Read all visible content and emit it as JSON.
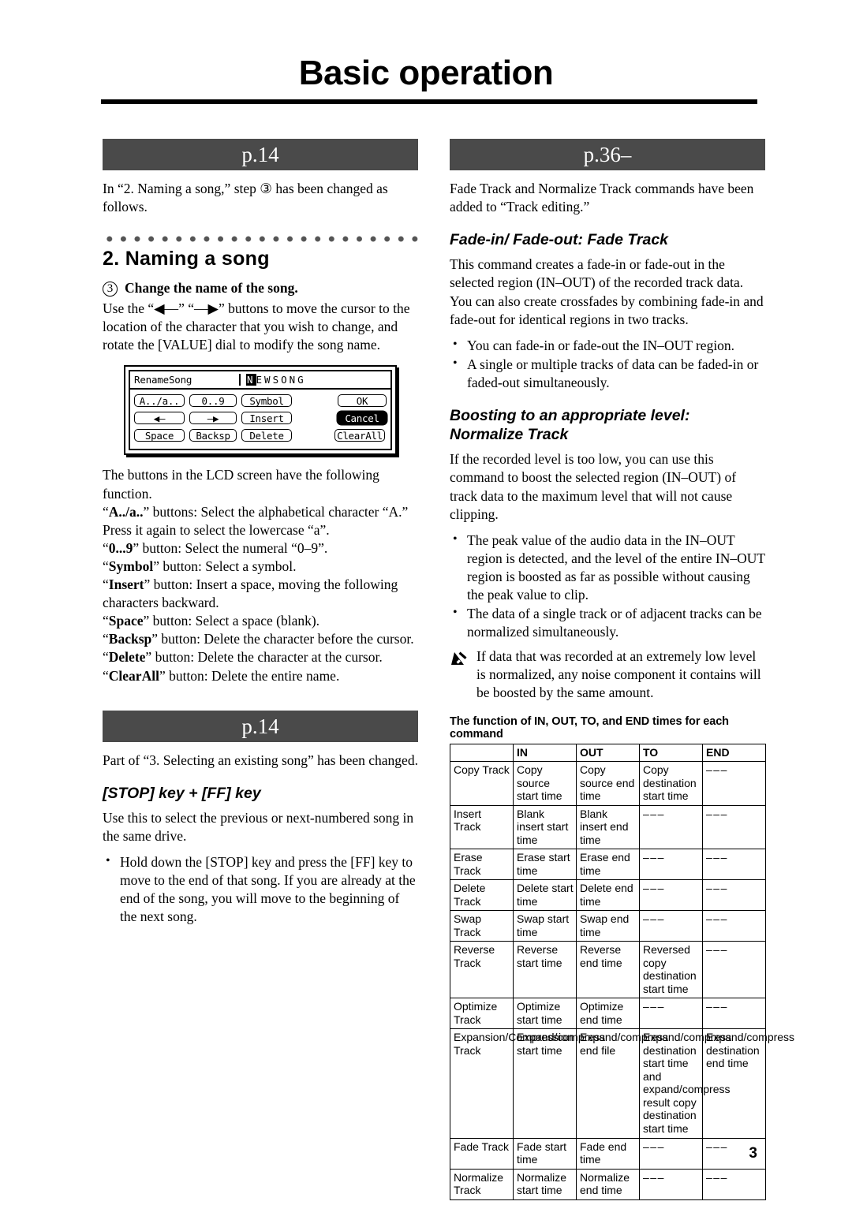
{
  "page": {
    "title": "Basic operation",
    "folio": "3",
    "accent_bar_color": "#4a4a4a",
    "bar_text_color": "#ffffff"
  },
  "left_column": {
    "ref_bar_1": "p.14",
    "intro_1": "In “2. Naming a song,” step ③ has been changed as follows.",
    "section_heading": "2. Naming a song",
    "step": {
      "number": "3",
      "label": "Change the name of the song."
    },
    "step_body": "Use the “◀—” “—▶” buttons to move the cursor to the location of the character that you wish to change, and rotate the [VALUE] dial to modify the song name.",
    "lcd": {
      "title": "RenameSong",
      "song_name_cursor": "N",
      "song_name_rest": "EWSONG",
      "buttons": {
        "alpha": "A../a..",
        "numeral": "0..9",
        "symbol": "Symbol",
        "ok": "OK",
        "left": "◀—",
        "right": "—▶",
        "insert": "Insert",
        "cancel": "Cancel",
        "space": "Space",
        "backsp": "Backsp",
        "delete": "Delete",
        "clearall": "ClearAll"
      }
    },
    "lcd_intro": "The buttons in the LCD screen have the following function.",
    "button_descriptions": [
      {
        "name": "A../a..",
        "rest": "” buttons: Select the alphabetical character “A.” Press it again to select the lowercase “a”."
      },
      {
        "name": "0...9",
        "rest": "” button: Select the numeral “0–9”."
      },
      {
        "name": "Symbol",
        "rest": "” button: Select a symbol."
      },
      {
        "name": "Insert",
        "rest": "” button: Insert a space, moving the following characters backward."
      },
      {
        "name": "Space",
        "rest": "” button: Select a space (blank)."
      },
      {
        "name": "Backsp",
        "rest": "” button: Delete the character before the cursor."
      },
      {
        "name": "Delete",
        "rest": "” button: Delete the character at the cursor."
      },
      {
        "name": "ClearAll",
        "rest": "” button: Delete the entire name."
      }
    ],
    "ref_bar_2": "p.14",
    "intro_2": "Part of “3. Selecting an existing song” has been changed.",
    "subhead_stop_ff": "[STOP] key + [FF] key",
    "stop_ff_body": "Use this to select the previous or next-numbered song in the same drive.",
    "stop_ff_bullets": [
      "Hold down the [STOP] key and press the [FF] key to move to the end of that song. If you are already at the end of the song, you will move to the beginning of the next song."
    ]
  },
  "right_column": {
    "ref_bar_1": "p.36–",
    "intro_1": "Fade Track and Normalize Track commands have been added to “Track editing.”",
    "fade": {
      "heading": "Fade-in/ Fade-out: Fade Track",
      "body": "This command creates a fade-in or fade-out in the selected region (IN–OUT) of the recorded track data. You can also create crossfades by combining fade-in and fade-out for identical regions in two tracks.",
      "bullets": [
        "You can fade-in or fade-out the IN–OUT region.",
        "A single or multiple tracks of data can be faded-in or faded-out simultaneously."
      ]
    },
    "normalize": {
      "heading": "Boosting to an appropriate level: Normalize Track",
      "body": "If the recorded level is too low, you can use this command to boost the selected region (IN–OUT) of track data to the maximum level that will not cause clipping.",
      "bullets": [
        "The peak value of the audio data in the IN–OUT region is detected, and the level of the entire IN–OUT region is boosted as far as possible without causing the peak value to clip.",
        "The data of a single track or of adjacent tracks can be normalized simultaneously."
      ],
      "note": "If data that was recorded at an extremely low level is normalized, any noise component it contains will be boosted by the same amount."
    },
    "table": {
      "caption": "The function of IN, OUT, TO, and END times for each command",
      "headers": [
        "",
        "IN",
        "OUT",
        "TO",
        "END"
      ],
      "rows": [
        [
          "Copy Track",
          "Copy source start time",
          "Copy source end time",
          "Copy destination start time",
          "–––"
        ],
        [
          "Insert Track",
          "Blank insert start time",
          "Blank insert end time",
          "–––",
          "–––"
        ],
        [
          "Erase Track",
          "Erase start time",
          "Erase end time",
          "–––",
          "–––"
        ],
        [
          "Delete Track",
          "Delete start time",
          "Delete end time",
          "–––",
          "–––"
        ],
        [
          "Swap Track",
          "Swap start time",
          "Swap end time",
          "–––",
          "–––"
        ],
        [
          "Reverse Track",
          "Reverse start time",
          "Reverse end time",
          "Reversed copy destination start time",
          "–––"
        ],
        [
          "Optimize Track",
          "Optimize start time",
          "Optimize end time",
          "–––",
          "–––"
        ],
        [
          "Expansion/Compression Track",
          "Expand/compress start time",
          "Expand/compress end file",
          "Expand/compress destination start time and expand/compress result copy destination start time",
          "Expand/compress destination end time"
        ],
        [
          "Fade Track",
          "Fade start time",
          "Fade end time",
          "–––",
          "–––"
        ],
        [
          "Normalize Track",
          "Normalize start time",
          "Normalize end time",
          "–––",
          "–––"
        ]
      ]
    }
  }
}
